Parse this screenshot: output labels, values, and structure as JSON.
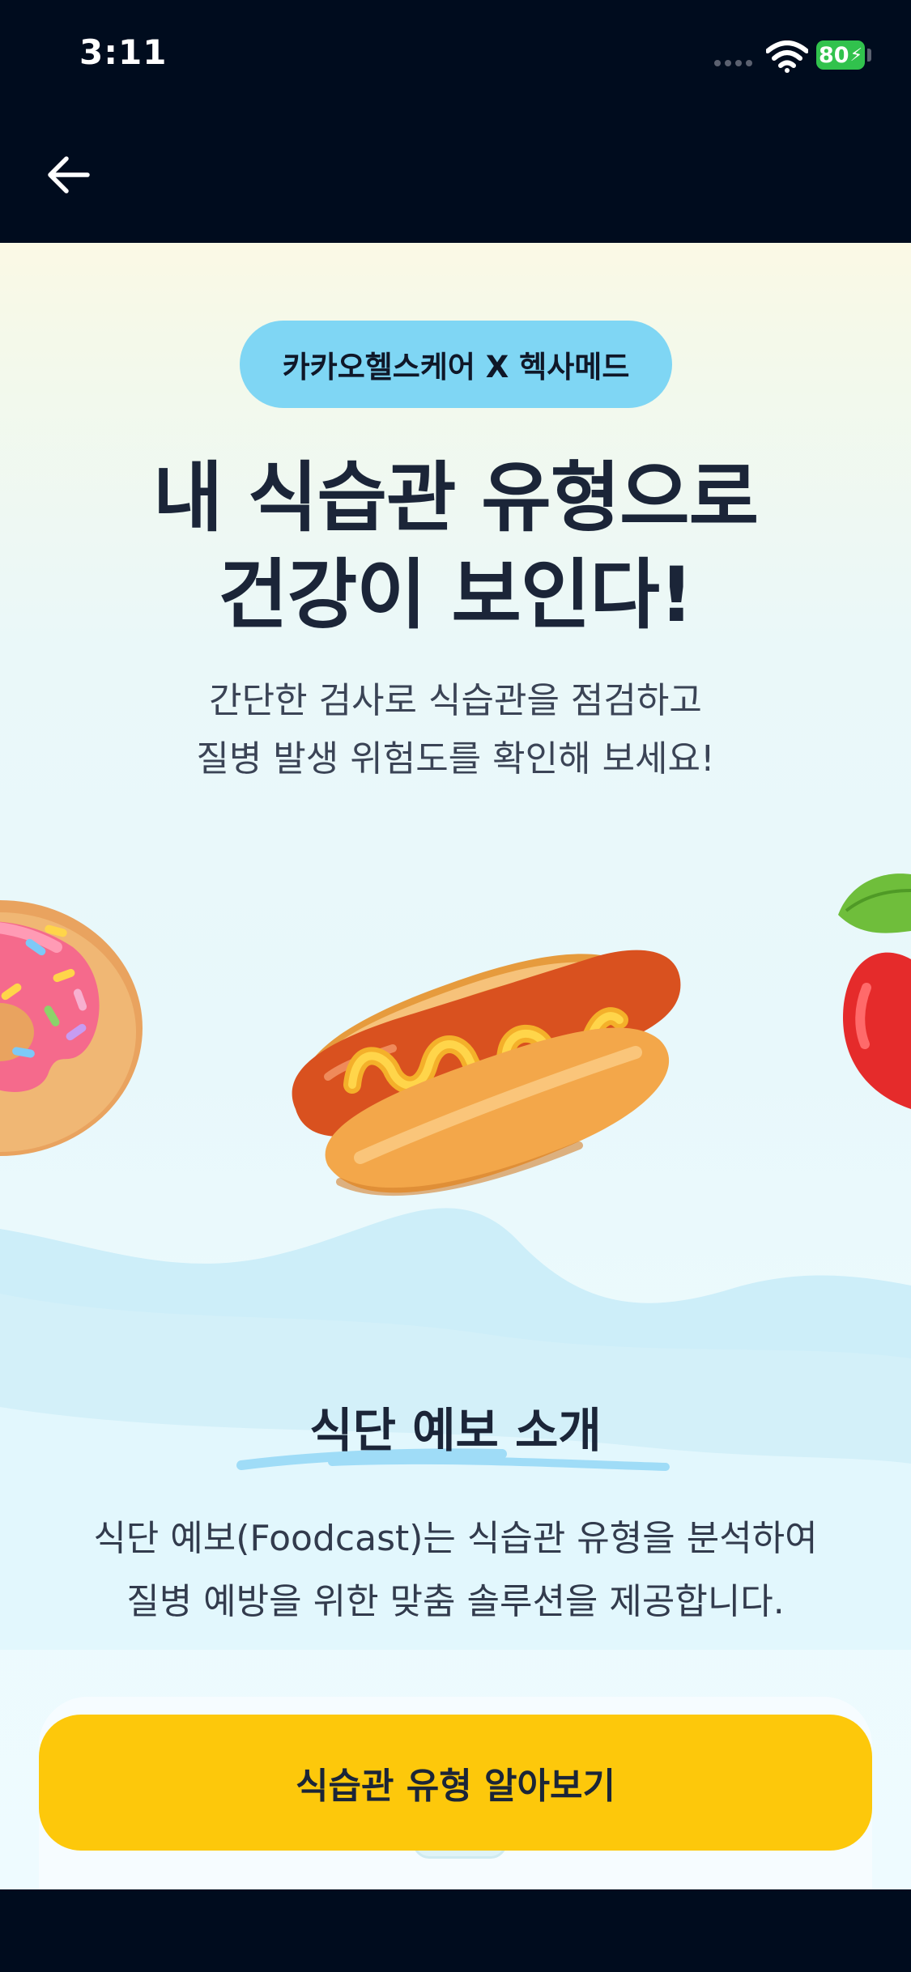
{
  "status_bar": {
    "time": "3:11",
    "battery": "80"
  },
  "nav": {
    "back_icon": "arrow-left-icon"
  },
  "hero": {
    "badge": "카카오헬스케어 X 헥사메드",
    "headline_line1": "내 식습관 유형으로",
    "headline_line2": "건강이 보인다!",
    "subtitle_line1": "간단한 검사로 식습관을 점검하고",
    "subtitle_line2": "질병 발생 위험도를 확인해 보세요!"
  },
  "illustrations": [
    "donut-illustration",
    "hotdog-illustration",
    "apple-illustration"
  ],
  "intro": {
    "title": "식단 예보 소개",
    "desc_line1": "식단 예보(Foodcast)는 식습관 유형을 분석하여",
    "desc_line2": "질병 예방을 위한 맞춤 솔루션을 제공합니다."
  },
  "cta": {
    "label": "식습관 유형 알아보기"
  },
  "colors": {
    "background": "#000c1e",
    "badge": "#7fd6f4",
    "cta": "#fdc80b",
    "text": "#1b2538"
  }
}
